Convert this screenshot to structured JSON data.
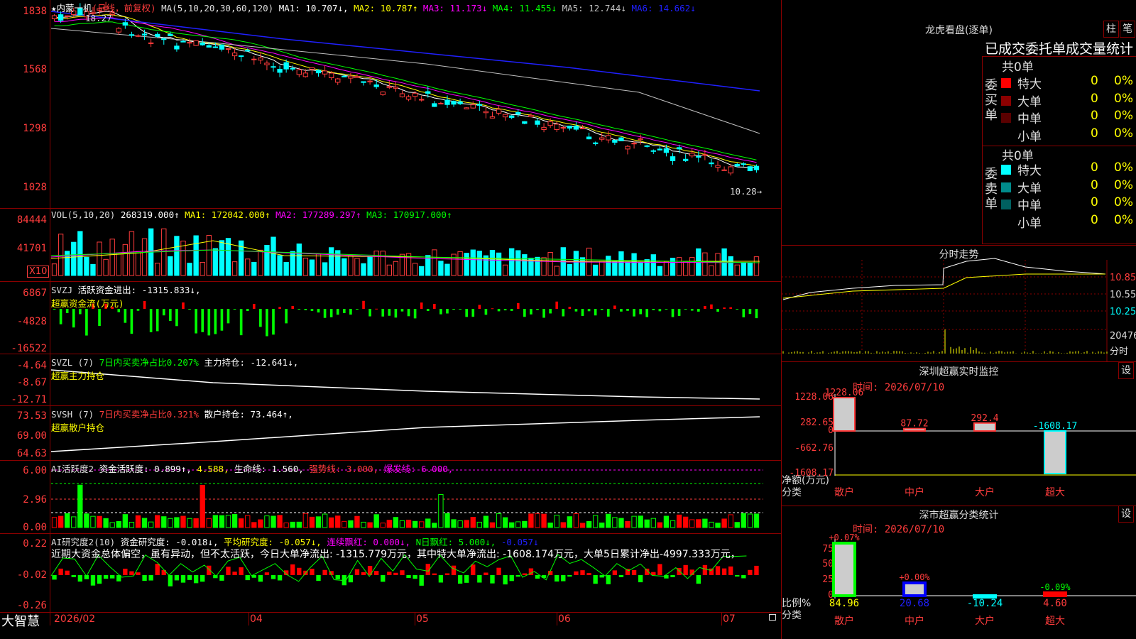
{
  "main": {
    "title": "★内蒙一机",
    "mode": "(日线，前复权)",
    "ma_params": "MA(5,10,20,30,60,120)",
    "ma": [
      {
        "label": "MA1: 10.707↓,",
        "color": "#ffffff"
      },
      {
        "label": "MA2: 10.787↑",
        "color": "#ffff00"
      },
      {
        "label": "MA3: 11.173↓",
        "color": "#ff00ff"
      },
      {
        "label": "MA4: 11.455↓",
        "color": "#00ff00"
      },
      {
        "label": "MA5: 12.744↓",
        "color": "#c0c0c0"
      },
      {
        "label": "MA6: 14.662↓",
        "color": "#2020ff"
      }
    ],
    "yticks": [
      "1838",
      "1568",
      "1298",
      "1028"
    ],
    "high_note": "18.27",
    "low_note": "10.28→"
  },
  "vol": {
    "header": "VOL(5,10,20)",
    "value": "268319.000↑",
    "ma": [
      {
        "label": "MA1: 172042.000↑",
        "color": "#ffffff"
      },
      {
        "label": "MA2: 177289.297↑",
        "color": "#ff00ff"
      },
      {
        "label": "MA3: 170917.000↑",
        "color": "#00ff00"
      }
    ],
    "yticks": [
      "84444",
      "41701"
    ],
    "unit": "X10"
  },
  "svzj": {
    "header": "SVZJ",
    "line1": "活跃资金进出: -1315.833↓,",
    "line2": "超赢资金流(万元)",
    "yticks": [
      "6867",
      "-4828",
      "-16522"
    ]
  },
  "svzl": {
    "header": "SVZL (7)",
    "ratio": "7日内买卖净占比0.207%",
    "pos": "主力持仓: -12.641↓,",
    "line2": "超赢主力持仓",
    "yticks": [
      "-4.64",
      "-8.67",
      "-12.71"
    ]
  },
  "svsh": {
    "header": "SVSH (7)",
    "ratio": "7日内买卖净占比0.321%",
    "pos": "散户持仓: 73.464↑,",
    "line2": "超赢散户持仓",
    "yticks": [
      "73.53",
      "69.00",
      "64.63"
    ]
  },
  "ai1": {
    "header": "AI活跃度2",
    "a": "资金活跃度: 0.899↑,",
    "b": "4.588,",
    "c": "生命线: 1.560,",
    "d": "强势线: 3.000,",
    "e": "爆发线: 6.000,",
    "yticks": [
      "6.00",
      "2.96",
      "0.00"
    ]
  },
  "ai2": {
    "header": "AI研究度2(10)",
    "a": "资金研究度: -0.018↓,",
    "b": "平均研究度: -0.057↓,",
    "c": "连续飘红: 0.000↓,",
    "d": "N日飘红: 5.000↓,",
    "e": "-0.057↓",
    "summary": "近期大资金总体偏空，虽有异动，但不太活跃，今日大单净流出: -1315.779万元，其中特大单净流出: -1608.174万元，大单5日累计净出-4997.333万元，",
    "yticks": [
      "0.22",
      "-0.02",
      "-0.26"
    ]
  },
  "xaxis": {
    "brand": "大智慧",
    "labels": [
      "2026/02",
      "04",
      "05",
      "06",
      "07"
    ]
  },
  "lhkp": {
    "title": "龙虎看盘(逐单)",
    "btn1": "柱",
    "btn2": "笔",
    "subtitle": "已成交委托单成交量统计",
    "buy_side": "委买单",
    "sell_side": "委卖单",
    "buy_total": "共0单",
    "sell_total": "共0单",
    "buy_rows": [
      {
        "name": "特大",
        "count": "0",
        "pct": "0%",
        "color": "#ff0000"
      },
      {
        "name": "大单",
        "count": "0",
        "pct": "0%",
        "color": "#8b0000"
      },
      {
        "name": "中单",
        "count": "0",
        "pct": "0%",
        "color": "#5a0000"
      },
      {
        "name": "小单",
        "count": "0",
        "pct": "0%",
        "color": "#000000"
      }
    ],
    "sell_rows": [
      {
        "name": "特大",
        "count": "0",
        "pct": "0%",
        "color": "#00ffff"
      },
      {
        "name": "大单",
        "count": "0",
        "pct": "0%",
        "color": "#008b8b"
      },
      {
        "name": "中单",
        "count": "0",
        "pct": "0%",
        "color": "#006060"
      },
      {
        "name": "小单",
        "count": "0",
        "pct": "0%",
        "color": "#000000"
      }
    ]
  },
  "intraday": {
    "title": "分时走势",
    "yticks": [
      "10.85",
      "10.55",
      "10.25"
    ],
    "vol_tick": "20476",
    "vol_label": "分时"
  },
  "sz_monitor": {
    "title": "深圳超赢实时监控",
    "btn": "设",
    "time": "时间: 2026/07/10",
    "yticks": [
      "1228.06",
      "282.65",
      "0",
      "-662.76",
      "-1608.17"
    ],
    "ylabel1": "净额(万元)",
    "ylabel2": "分类",
    "bars": [
      {
        "cat": "散户",
        "value": 1228.06,
        "label": "1228.06",
        "color": "#ff3c3c"
      },
      {
        "cat": "中户",
        "value": 87.72,
        "label": "87.72",
        "color": "#ff3c3c"
      },
      {
        "cat": "大户",
        "value": 292.4,
        "label": "292.4",
        "color": "#ff3c3c"
      },
      {
        "cat": "超大",
        "value": -1608.17,
        "label": "-1608.17",
        "color": "#00ffff"
      }
    ]
  },
  "sz_class": {
    "title": "深市超赢分类统计",
    "btn": "设",
    "time": "时间: 2026/07/10",
    "yticks": [
      "75",
      "50",
      "25",
      "0"
    ],
    "ylabel1": "比例%",
    "ylabel2": "分类",
    "bars": [
      {
        "cat": "散户",
        "value": 84.96,
        "label": "84.96",
        "change": "+0.07%",
        "fill": "#00ff00",
        "color": "#ffff00",
        "chcolor": "#ff3c3c"
      },
      {
        "cat": "中户",
        "value": 20.68,
        "label": "20.68",
        "change": "+0.00%",
        "fill": "#0000ff",
        "color": "#2020ff",
        "chcolor": "#ff3c3c"
      },
      {
        "cat": "大户",
        "value": -10.24,
        "label": "-10.24",
        "change": "",
        "fill": "#00ffff",
        "color": "#00ffff",
        "chcolor": "#ff3c3c"
      },
      {
        "cat": "超大",
        "value": 4.6,
        "label": "4.60",
        "change": "-0.09%",
        "fill": "#ff0000",
        "color": "#ff3c3c",
        "chcolor": "#00ff00"
      }
    ]
  }
}
